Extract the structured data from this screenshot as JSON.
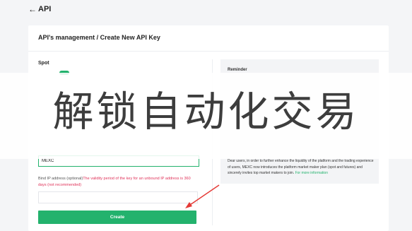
{
  "header": {
    "back_icon": "arrow-left-icon",
    "title": "API"
  },
  "card": {
    "breadcrumb": "API's management / Create New API Key"
  },
  "form": {
    "spot_label": "Spot",
    "name_value": "MEXC",
    "ip_label": "Bind IP address (optional)",
    "ip_warning": "The validity period of the key for an unbound IP address is 360 days (not recommended)",
    "ip_value": "",
    "create_label": "Create"
  },
  "reminder": {
    "title": "Reminder",
    "text": "Dear users, in order to further enhance the liquidity of the platform and the trading experience of users, MEXC now introduces the platform market maker plan (spot and futures) and sincerely invites top market makers to join.",
    "link": "For more information"
  },
  "overlay": {
    "text": "解锁自动化交易"
  },
  "colors": {
    "accent": "#23b26d",
    "warning": "#e0335a",
    "annotation_arrow": "#e53935"
  }
}
